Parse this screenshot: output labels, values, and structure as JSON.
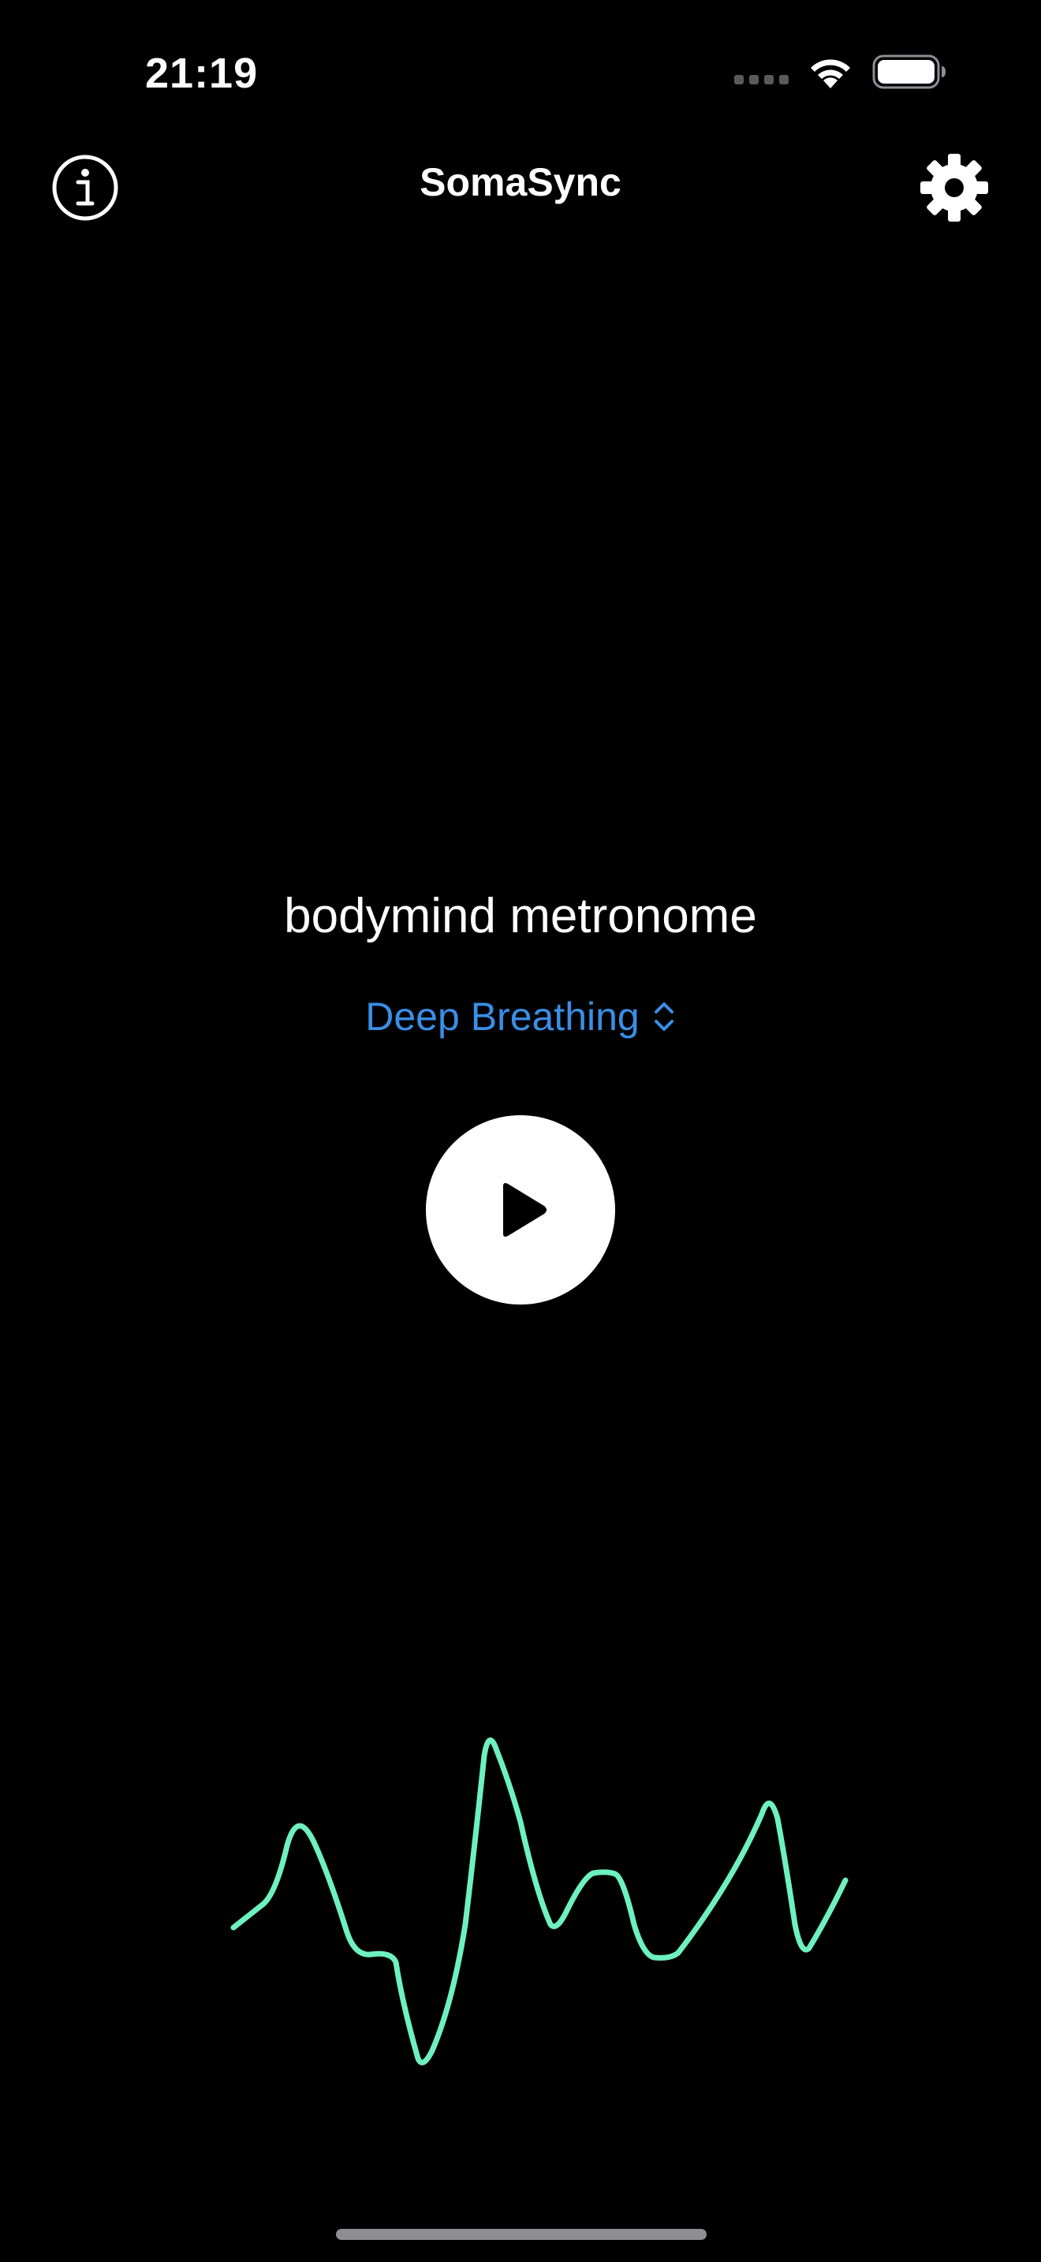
{
  "status_bar": {
    "time": "21:19",
    "icons": [
      "cellular-signal-icon",
      "wifi-icon",
      "battery-icon"
    ]
  },
  "nav": {
    "title": "SomaSync",
    "left_icon": "info-icon",
    "right_icon": "gear-icon"
  },
  "main": {
    "title": "bodymind metronome",
    "mode": {
      "selected": "Deep Breathing",
      "icon": "chevron-up-down-icon"
    },
    "play_icon": "play-icon"
  },
  "waveform": {
    "icon": "waveform-graph",
    "color": "#6ef0c0"
  },
  "colors": {
    "background": "#000000",
    "accent": "#3a8ee6",
    "wave": "#6ef0c0"
  }
}
